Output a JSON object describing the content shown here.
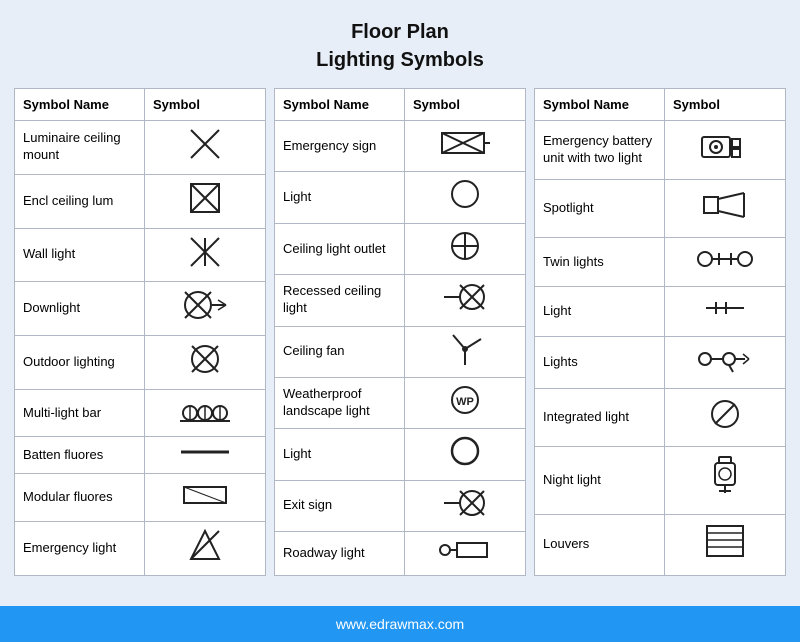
{
  "title": [
    "Floor Plan",
    "Lighting Symbols"
  ],
  "footer": "www.edrawmax.com",
  "tables": [
    {
      "headers": [
        "Symbol Name",
        "Symbol"
      ],
      "rows": [
        {
          "name": "Luminaire ceiling mount",
          "symbol": "lum_ceil"
        },
        {
          "name": "Encl ceiling lum",
          "symbol": "encl_ceil"
        },
        {
          "name": "Wall light",
          "symbol": "wall_light"
        },
        {
          "name": "Downlight",
          "symbol": "downlight"
        },
        {
          "name": "Outdoor lighting",
          "symbol": "outdoor"
        },
        {
          "name": "Multi-light bar",
          "symbol": "multi_bar"
        },
        {
          "name": "Batten fluores",
          "symbol": "batten"
        },
        {
          "name": "Modular fluores",
          "symbol": "modular"
        },
        {
          "name": "Emergency light",
          "symbol": "emerg_light"
        }
      ]
    },
    {
      "headers": [
        "Symbol Name",
        "Symbol"
      ],
      "rows": [
        {
          "name": "Emergency sign",
          "symbol": "emerg_sign"
        },
        {
          "name": "Light",
          "symbol": "light_circle"
        },
        {
          "name": "Ceiling light outlet",
          "symbol": "ceil_outlet"
        },
        {
          "name": "Recessed ceiling light",
          "symbol": "recess_ceil"
        },
        {
          "name": "Ceiling fan",
          "symbol": "ceil_fan"
        },
        {
          "name": "Weatherproof landscape light",
          "symbol": "weatherproof"
        },
        {
          "name": "Light",
          "symbol": "light_circle2"
        },
        {
          "name": "Exit sign",
          "symbol": "exit_sign"
        },
        {
          "name": "Roadway light",
          "symbol": "roadway"
        }
      ]
    },
    {
      "headers": [
        "Symbol Name",
        "Symbol"
      ],
      "rows": [
        {
          "name": "Emergency battery unit with two light",
          "symbol": "emerg_battery"
        },
        {
          "name": "Spotlight",
          "symbol": "spotlight"
        },
        {
          "name": "Twin lights",
          "symbol": "twin_lights"
        },
        {
          "name": "Light",
          "symbol": "light_simple"
        },
        {
          "name": "Lights",
          "symbol": "lights_multi"
        },
        {
          "name": "Integrated light",
          "symbol": "integrated"
        },
        {
          "name": "Night light",
          "symbol": "night_light"
        },
        {
          "name": "Louvers",
          "symbol": "louvers"
        }
      ]
    }
  ]
}
